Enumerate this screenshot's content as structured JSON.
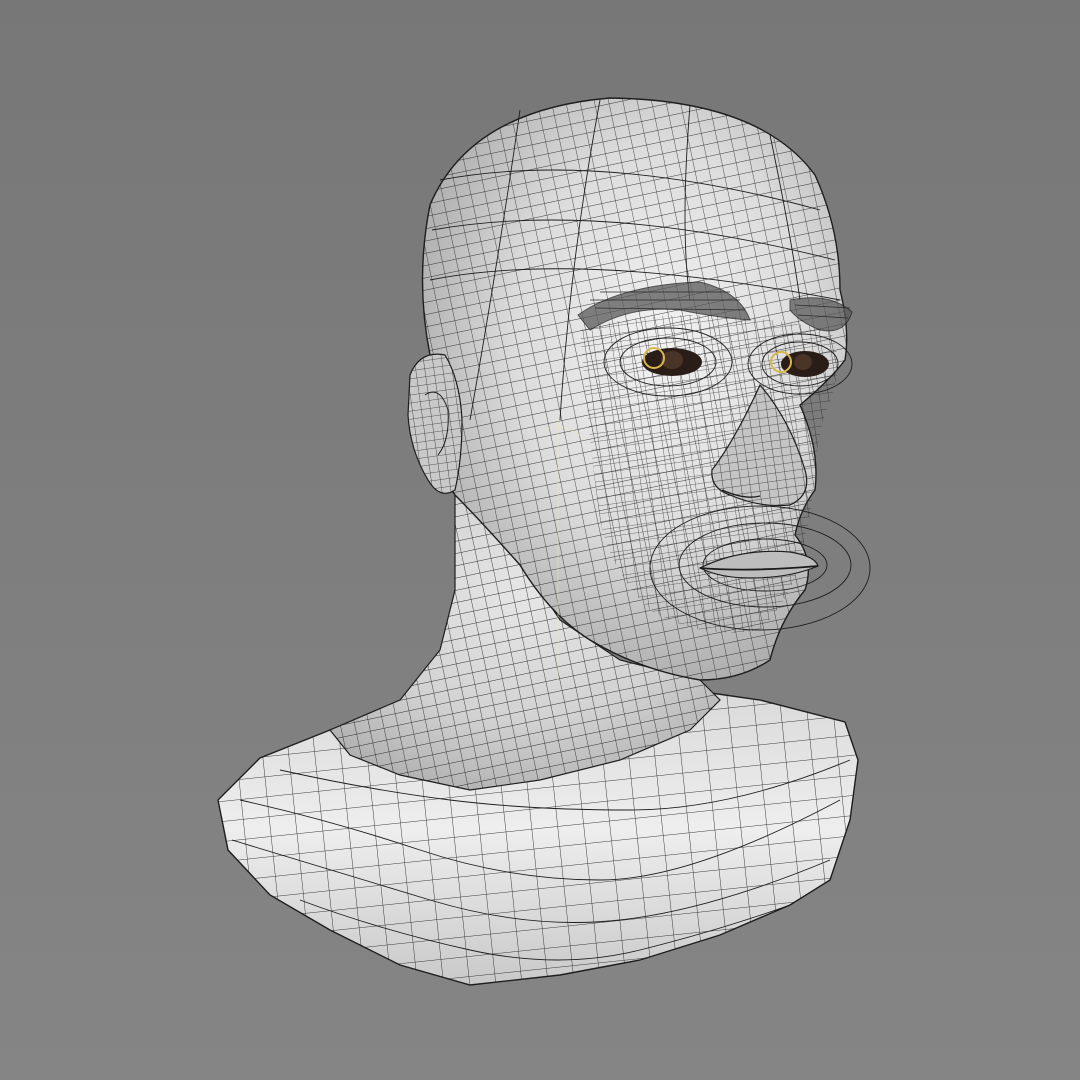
{
  "viewport": {
    "background_top": "#777777",
    "background_bottom": "#858585"
  },
  "model": {
    "subject": "head-bust-wireframe",
    "shading": "wireframe-on-shaded",
    "surface_color": "#d6d6d6",
    "wire_color": "#1e1e1e",
    "eye_color": "#2a1d17",
    "highlight_color": "#d8b84a"
  }
}
